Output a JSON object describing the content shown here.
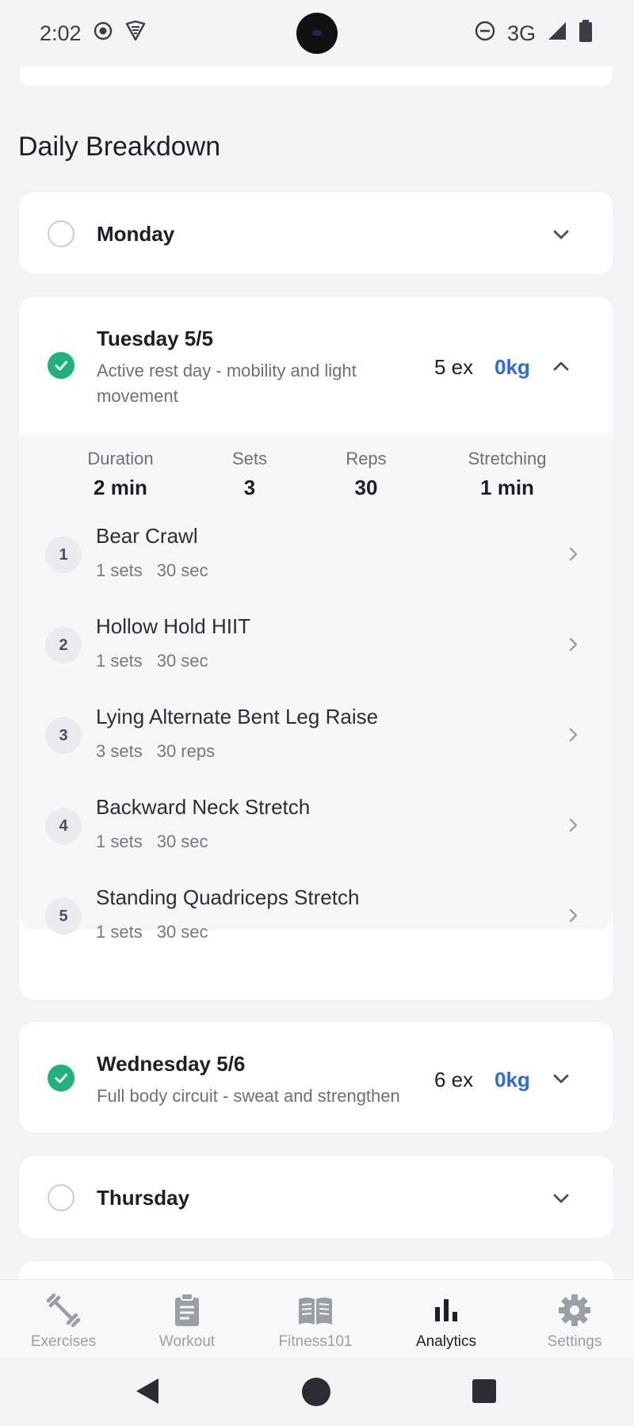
{
  "status_bar": {
    "time": "2:02",
    "network": "3G"
  },
  "section": {
    "title": "Daily Breakdown"
  },
  "days": [
    {
      "name": "Monday",
      "completed": false,
      "expanded": false
    },
    {
      "name": "Tuesday 5/5",
      "completed": true,
      "expanded": true,
      "description": "Active rest day - mobility and light movement",
      "description_line1": "Active rest day - mobility and light",
      "description_line2": "movement",
      "exercise_count": "5 ex",
      "weight": "0kg",
      "stats": [
        {
          "label": "Duration",
          "value": "2 min"
        },
        {
          "label": "Sets",
          "value": "3"
        },
        {
          "label": "Reps",
          "value": "30"
        },
        {
          "label": "Stretching",
          "value": "1 min"
        }
      ],
      "exercises": [
        {
          "num": "1",
          "name": "Bear Crawl",
          "sets": "1 sets",
          "amount": "30 sec"
        },
        {
          "num": "2",
          "name": "Hollow Hold HIIT",
          "sets": "1 sets",
          "amount": "30 sec"
        },
        {
          "num": "3",
          "name": "Lying Alternate Bent Leg Raise",
          "sets": "3 sets",
          "amount": "30 reps"
        },
        {
          "num": "4",
          "name": "Backward Neck Stretch",
          "sets": "1 sets",
          "amount": "30 sec"
        },
        {
          "num": "5",
          "name": "Standing Quadriceps Stretch",
          "sets": "1 sets",
          "amount": "30 sec"
        }
      ]
    },
    {
      "name": "Wednesday 5/6",
      "completed": true,
      "expanded": false,
      "description": "Full body circuit - sweat and strengthen",
      "exercise_count": "6 ex",
      "weight": "0kg"
    },
    {
      "name": "Thursday",
      "completed": false,
      "expanded": false
    }
  ],
  "bottom_nav": {
    "items": [
      {
        "label": "Exercises",
        "icon": "dumbbell-icon",
        "active": false
      },
      {
        "label": "Workout",
        "icon": "clipboard-icon",
        "active": false
      },
      {
        "label": "Fitness101",
        "icon": "book-icon",
        "active": false
      },
      {
        "label": "Analytics",
        "icon": "bar-chart-icon",
        "active": true
      },
      {
        "label": "Settings",
        "icon": "gear-icon",
        "active": false
      }
    ]
  },
  "colors": {
    "accent": "#2f6bdf",
    "success": "#1fb27b",
    "background": "#f3f4f6"
  }
}
